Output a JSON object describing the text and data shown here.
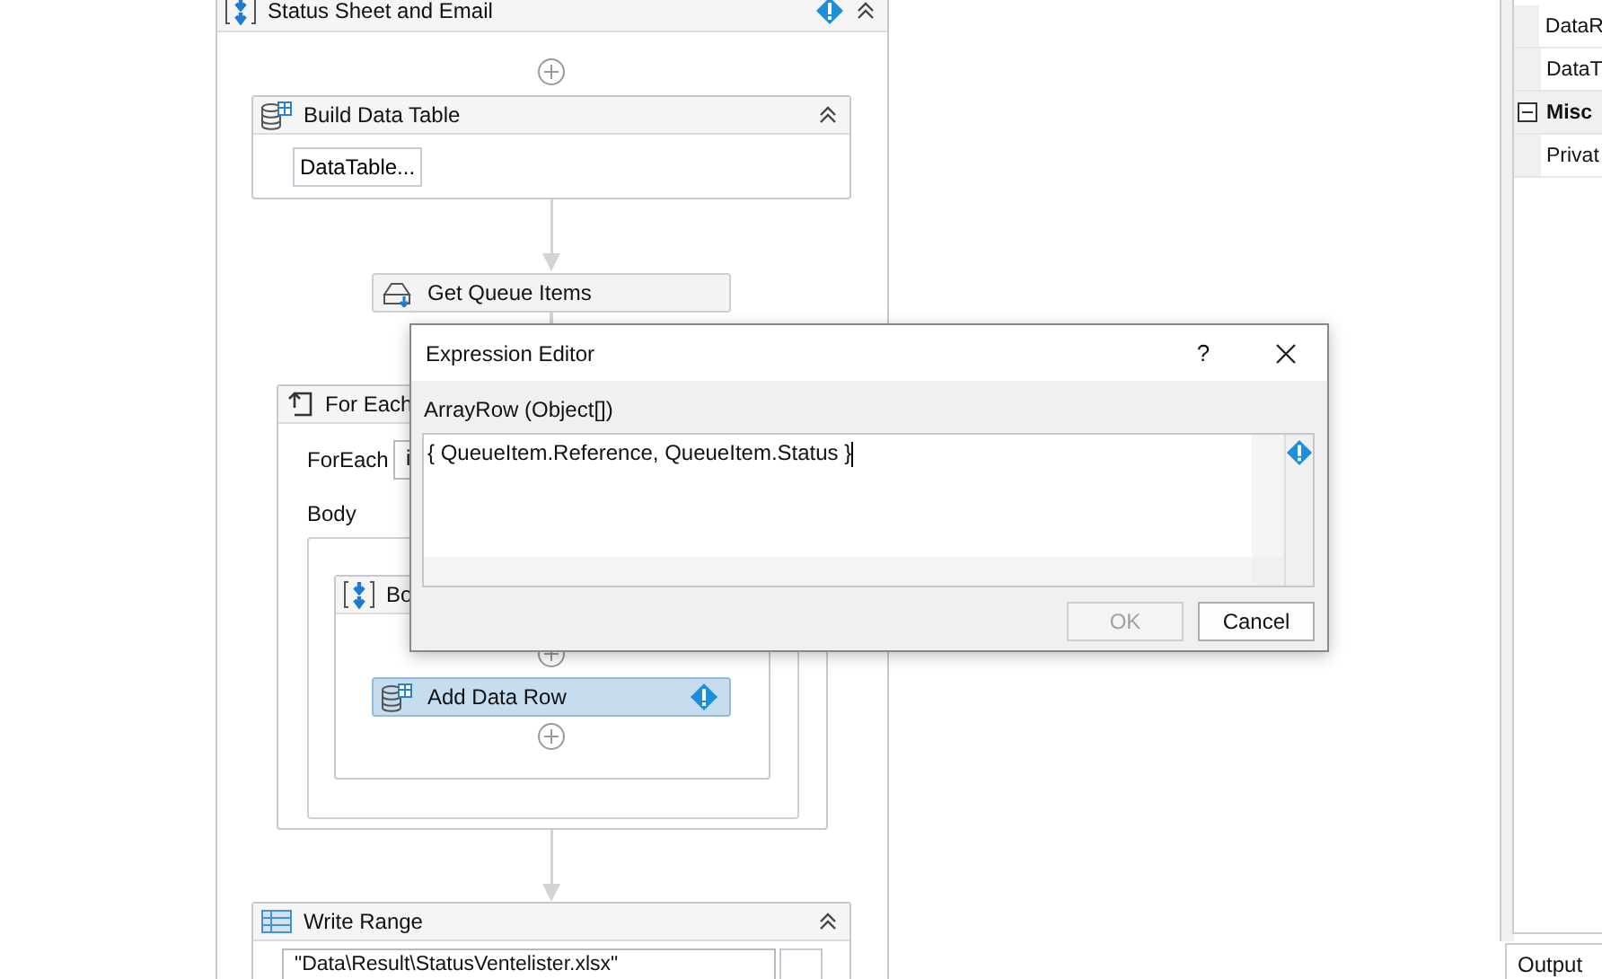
{
  "sequence": {
    "title": "Status Sheet and Email",
    "warning": true,
    "expanded": true
  },
  "build_data_table": {
    "title": "Build Data Table",
    "expanded": true,
    "button": "DataTable..."
  },
  "get_queue_items": {
    "title": "Get Queue Items",
    "selected": false
  },
  "for_each": {
    "title": "For Each",
    "foreach_label": "ForEach",
    "foreach_value": "i",
    "body_label": "Body"
  },
  "body_sequence": {
    "title": "Bo"
  },
  "add_data_row": {
    "title": "Add Data Row",
    "selected": true,
    "warning": true
  },
  "write_range": {
    "title": "Write Range",
    "expanded": true,
    "path": "\"Data\\Result\\StatusVentelister.xlsx\""
  },
  "properties": [
    {
      "kind": "row",
      "label": "DataR"
    },
    {
      "kind": "row",
      "label": "DataT"
    },
    {
      "kind": "category",
      "label": "Misc",
      "expanded": true
    },
    {
      "kind": "row",
      "label": "Privat"
    }
  ],
  "output_tab": "Output",
  "dialog": {
    "title": "Expression Editor",
    "help": "?",
    "label": "ArrayRow (Object[])",
    "expression": "{ QueueItem.Reference, QueueItem.Status }",
    "warning": true,
    "buttons": [
      {
        "label": "OK",
        "disabled": true
      },
      {
        "label": "Cancel",
        "disabled": false
      }
    ]
  }
}
